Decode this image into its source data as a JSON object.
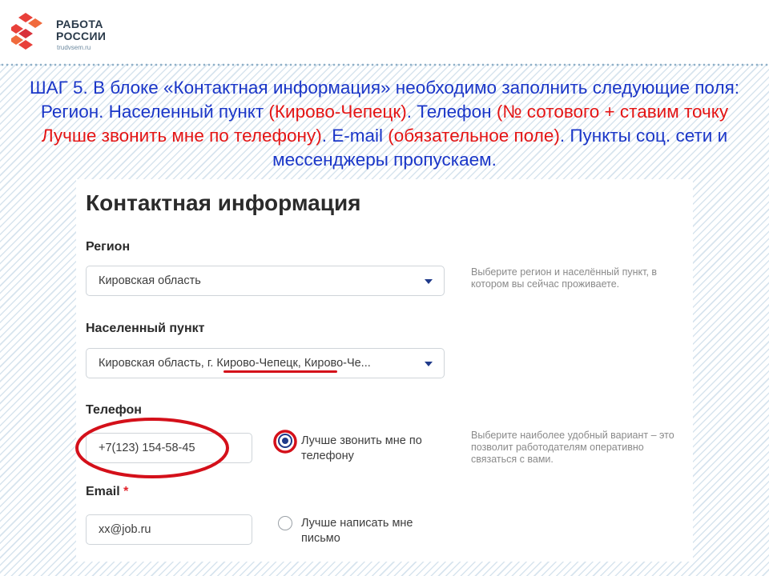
{
  "logo": {
    "line1": "РАБОТА",
    "line2": "РОССИИ",
    "url": "trudvsem.ru"
  },
  "instruction": {
    "p1": "ШАГ 5. В блоке «Контактная информация» необходимо заполнить следующие поля: Регион. Населенный пункт ",
    "p2": "(Кирово-Чепецк)",
    "p3": ". Телефон ",
    "p4": "(№ сотового + ставим точку Лучше звонить мне по телефону)",
    "p5": ". E-mail ",
    "p6": "(обязательное поле)",
    "p7": ". Пункты соц. сети и мессенджеры пропускаем."
  },
  "form": {
    "title": "Контактная информация",
    "region": {
      "label": "Регион",
      "value": "Кировская область",
      "hint": "Выберите регион и населённый пункт, в котором вы сейчас проживаете."
    },
    "locality": {
      "label": "Населенный пункт",
      "value": "Кировская область, г. Кирово-Чепецк, Кирово-Че..."
    },
    "phone": {
      "label": "Телефон",
      "value": "+7(123) 154-58-45",
      "option_label": "Лучше звонить мне по телефону",
      "option_checked": true,
      "hint": "Выберите наиболее удобный вариант – это позволит работодателям оперативно связаться с вами."
    },
    "email": {
      "label": "Email",
      "required_mark": "*",
      "value": "xx@job.ru",
      "option_label": "Лучше написать мне письмо",
      "option_checked": false
    }
  },
  "colors": {
    "instruction_blue": "#1a36c8",
    "instruction_red": "#e41414",
    "annotation_red": "#d4101a",
    "radio_accent": "#1f3a8a"
  }
}
